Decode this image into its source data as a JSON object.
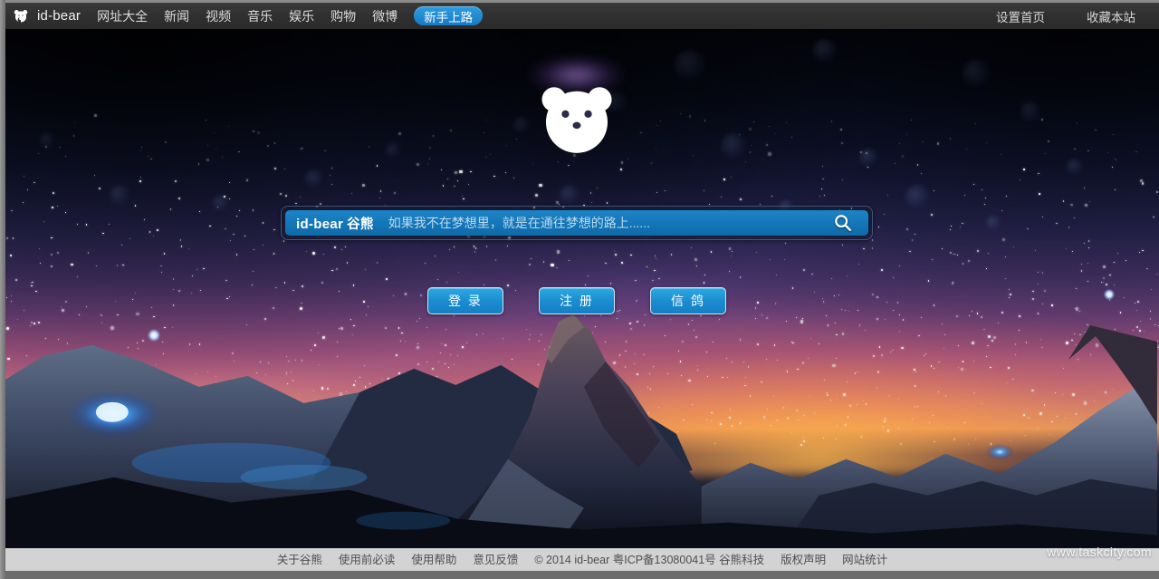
{
  "topbar": {
    "logo_icon": "bear-icon",
    "brand": "id-bear",
    "nav": [
      {
        "label": "网址大全",
        "name": "nav-sites"
      },
      {
        "label": "新闻",
        "name": "nav-news"
      },
      {
        "label": "视频",
        "name": "nav-video"
      },
      {
        "label": "音乐",
        "name": "nav-music"
      },
      {
        "label": "娱乐",
        "name": "nav-entertainment"
      },
      {
        "label": "购物",
        "name": "nav-shopping"
      },
      {
        "label": "微博",
        "name": "nav-weibo"
      }
    ],
    "pill": {
      "label": "新手上路",
      "name": "nav-newbie",
      "bg": "#1e86cd"
    },
    "right": [
      {
        "label": "设置首页",
        "name": "set-homepage"
      },
      {
        "label": "收藏本站",
        "name": "bookmark-site"
      }
    ]
  },
  "hero": {
    "logo_icon": "bear-logo-icon",
    "search": {
      "brand_en": "id-bear",
      "brand_cn": "谷熊",
      "value": "",
      "placeholder": "如果我不在梦想里，就是在通往梦想的路上......",
      "button_icon": "search-icon",
      "accent": "#1476b8"
    },
    "buttons": [
      {
        "label": "登 录",
        "name": "login-button"
      },
      {
        "label": "注 册",
        "name": "register-button"
      },
      {
        "label": "信 鸽",
        "name": "pigeon-button"
      }
    ]
  },
  "footer": {
    "links_left": [
      {
        "label": "关于谷熊",
        "name": "footer-about"
      },
      {
        "label": "使用前必读",
        "name": "footer-must-read"
      },
      {
        "label": "使用帮助",
        "name": "footer-help"
      },
      {
        "label": "意见反馈",
        "name": "footer-feedback"
      }
    ],
    "copyright": "© 2014 id-bear 粤ICP备13080041号 谷熊科技",
    "links_right": [
      {
        "label": "版权声明",
        "name": "footer-copyright-notice"
      },
      {
        "label": "网站统计",
        "name": "footer-stats"
      }
    ]
  },
  "watermark": "www.taskcity.com"
}
